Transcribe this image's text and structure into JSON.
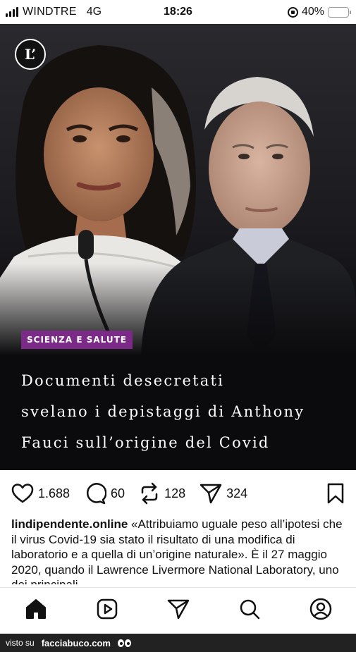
{
  "status_bar": {
    "carrier": "WINDTRE",
    "network": "4G",
    "time": "18:26",
    "battery_percent": "40%",
    "battery_level": 0.4,
    "battery_color": "#f2c318"
  },
  "post": {
    "logo_text": "L’",
    "category": "SCIENZA E SALUTE",
    "category_color": "#7b2a87",
    "headline_lines": [
      "Documenti desecretati",
      "svelano i depistaggi di Anthony",
      "Fauci sull’origine del Covid"
    ]
  },
  "actions": {
    "likes": "1.688",
    "comments": "60",
    "reposts": "128",
    "shares": "324",
    "icons": [
      "heart-icon",
      "comment-icon",
      "repost-icon",
      "send-icon",
      "bookmark-icon"
    ]
  },
  "caption": {
    "username": "lindipendente.online",
    "text": "«Attribuiamo uguale peso all’ipotesi che il virus Covid-19 sia stato il risultato di una modifica di laboratorio e a quella di un’origine naturale». È il 27 maggio 2020, quando il Lawrence Livermore National Laboratory, uno dei principali"
  },
  "bottom_nav": {
    "icons": [
      "home-icon",
      "reels-icon",
      "send-icon",
      "search-icon",
      "profile-icon"
    ]
  },
  "watermark": {
    "prefix": "visto su",
    "site": "facciabuco.com"
  }
}
